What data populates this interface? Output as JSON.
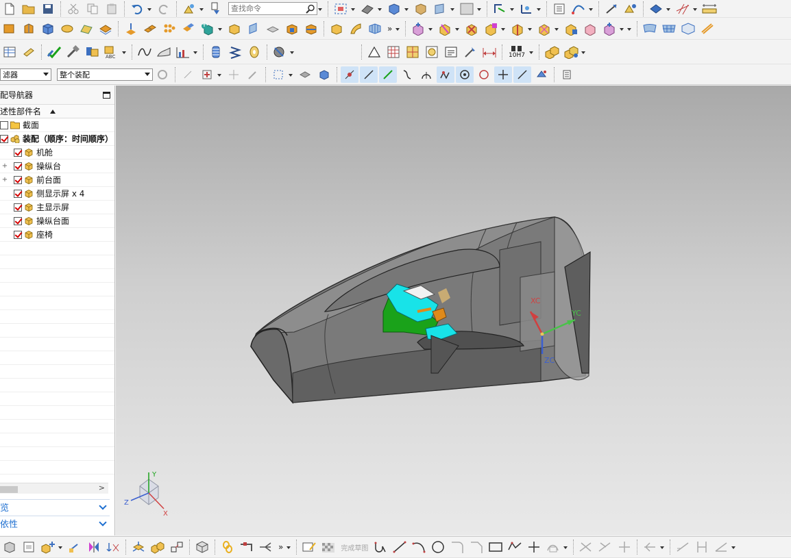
{
  "toolbar": {
    "search_placeholder": "查找命令",
    "selection_filter_label": "滤器",
    "assembly_scope_label": "整个装配",
    "more_glyph": "»",
    "tolerance_label": "10H7"
  },
  "navigator": {
    "title": "配导航器",
    "column_header": "述性部件名",
    "tree": [
      {
        "label": "截面",
        "checked": false,
        "icon": "folder-icon",
        "level": 0
      },
      {
        "label": "装配（顺序：时间顺序）",
        "checked": true,
        "icon": "assembly-icon",
        "level": 0,
        "bold": true
      },
      {
        "label": "机舱",
        "checked": true,
        "icon": "component-icon",
        "level": 1
      },
      {
        "label": "操纵台",
        "checked": true,
        "icon": "component-icon",
        "level": 1,
        "expandable": true
      },
      {
        "label": "前台面",
        "checked": true,
        "icon": "component-icon",
        "level": 1,
        "expandable": true
      },
      {
        "label": "侧显示屏 x 4",
        "checked": true,
        "icon": "component-icon",
        "level": 1
      },
      {
        "label": "主显示屏",
        "checked": true,
        "icon": "component-icon",
        "level": 1
      },
      {
        "label": "操纵台面",
        "checked": true,
        "icon": "component-icon",
        "level": 1
      },
      {
        "label": "座椅",
        "checked": true,
        "icon": "component-icon",
        "level": 1
      }
    ],
    "panels": [
      {
        "label": "览"
      },
      {
        "label": "依性"
      }
    ]
  },
  "viewport": {
    "wcs_labels": {
      "xc": "XC",
      "yc": "YC",
      "zc": "ZC"
    },
    "triad_labels": {
      "x": "X",
      "y": "Y",
      "z": "Z"
    }
  },
  "bottom_toolbar": {
    "finish_sketch_label": "完成草图",
    "more_glyph": "»"
  },
  "colors": {
    "accent": "#1e6fd0",
    "check": "#d40000",
    "canopy_gray": "#6f6f6f",
    "display_cyan": "#18e3e8",
    "console_green": "#1aa21a",
    "seat_orange": "#e08a1a"
  }
}
